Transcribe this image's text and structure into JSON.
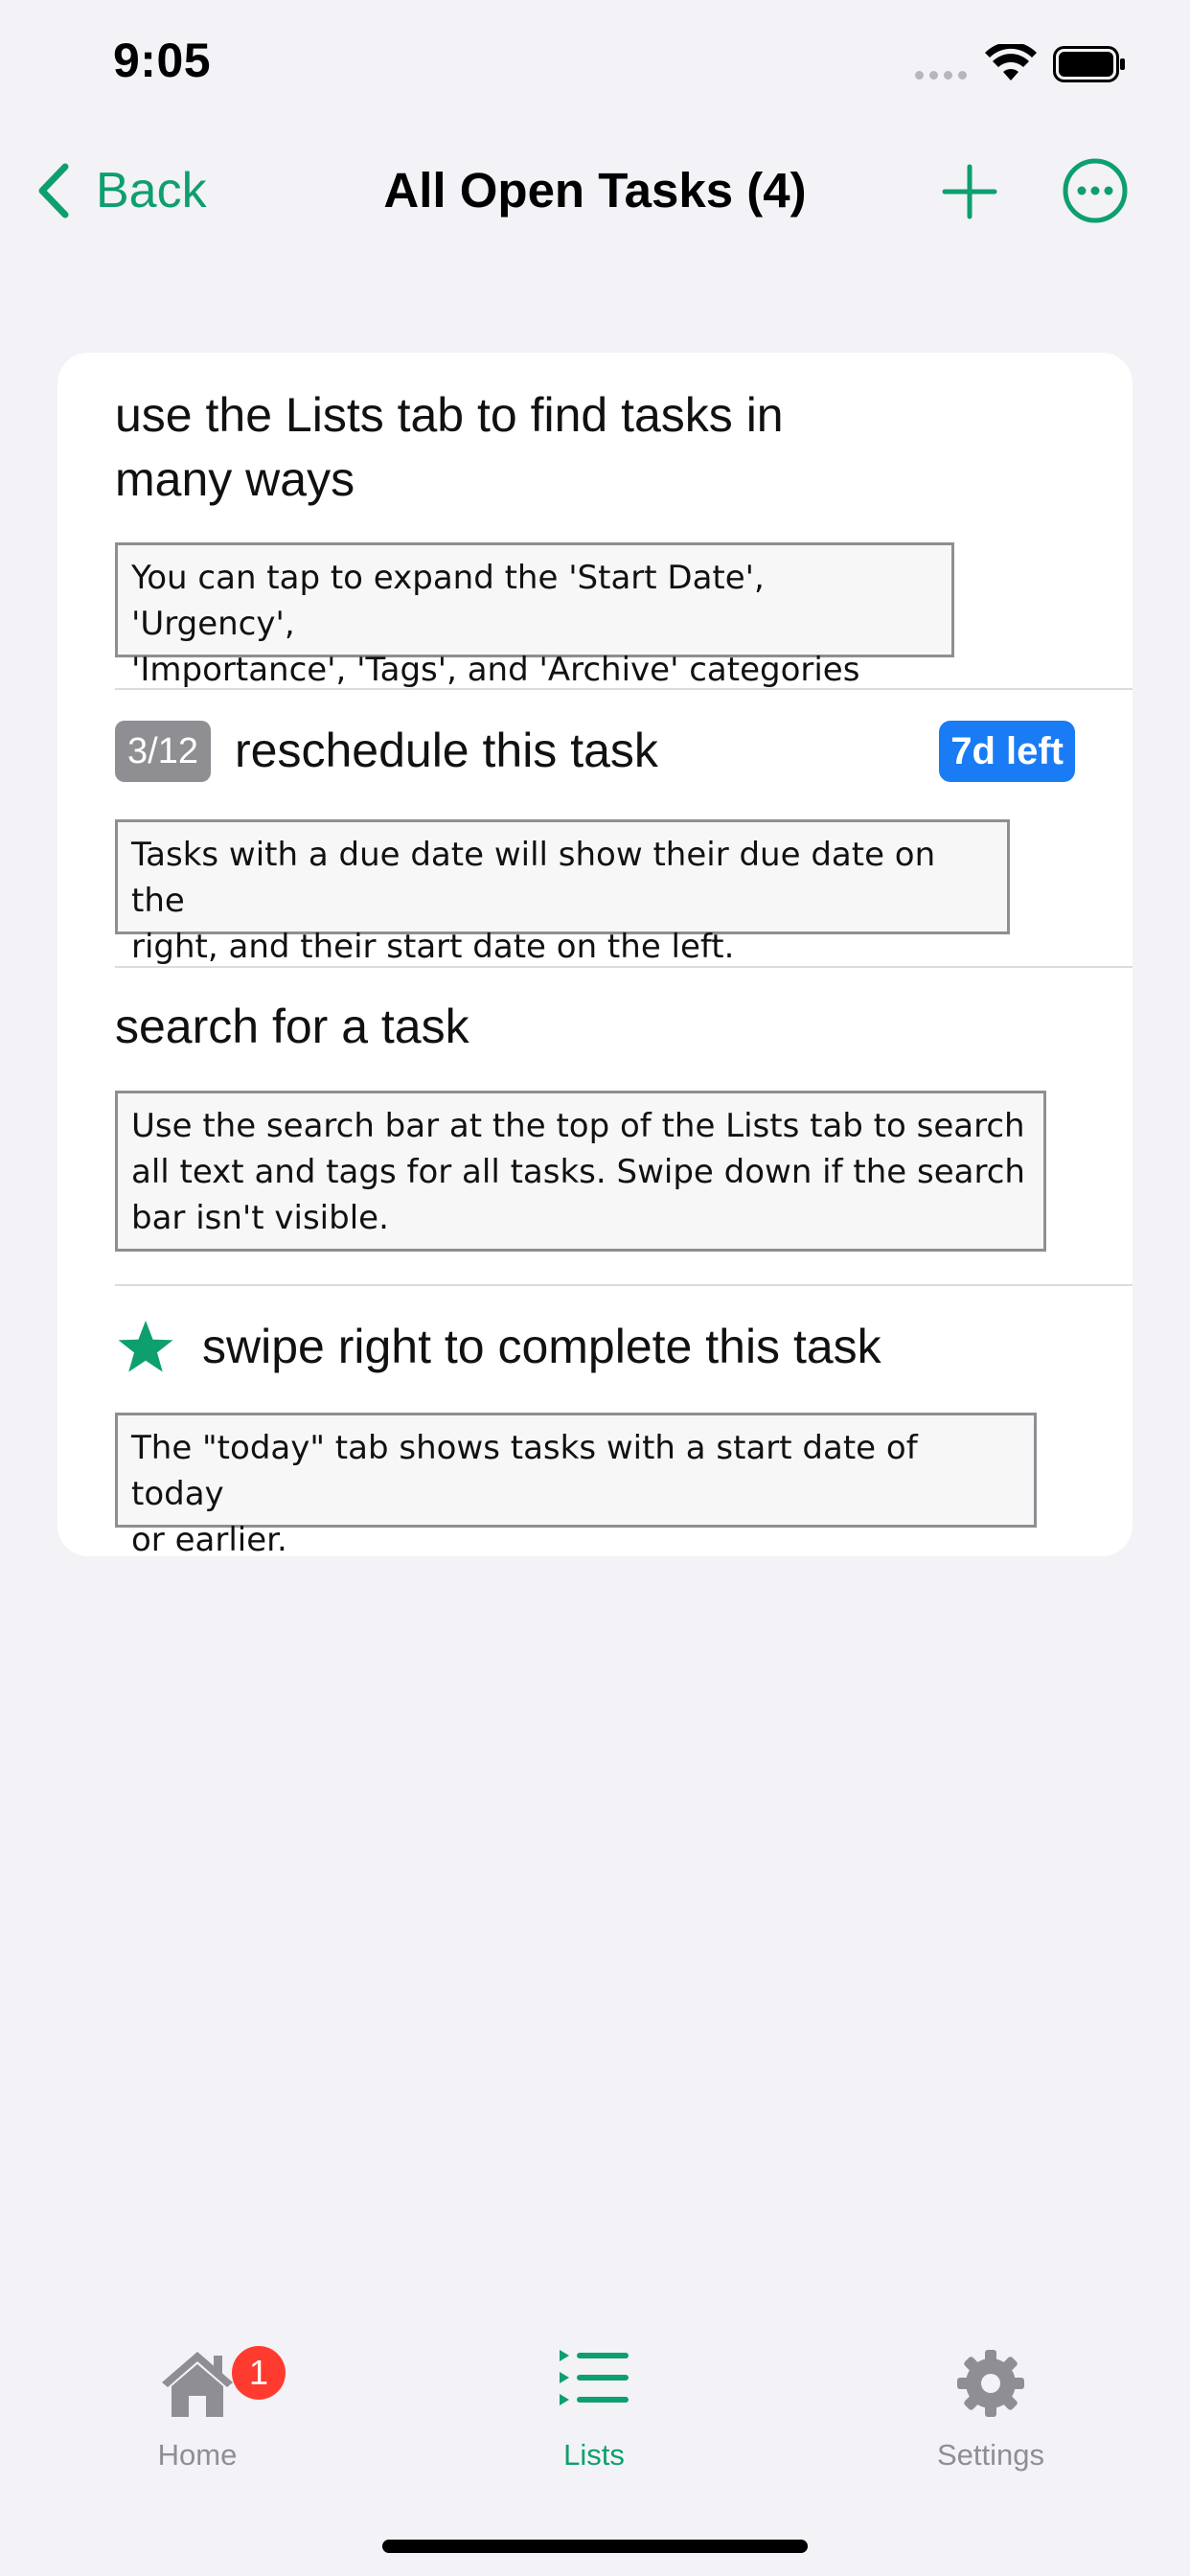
{
  "status_bar": {
    "time": "9:05"
  },
  "nav": {
    "back_label": "Back",
    "title": "All Open Tasks (4)",
    "add_icon": "plus-icon",
    "more_icon": "ellipsis-circle-icon"
  },
  "tasks": [
    {
      "title_line1": "use the Lists tab to find tasks in",
      "title_line2": "many ways",
      "note_line1": "You can tap to expand the 'Start Date', 'Urgency',",
      "note_line2": "'Importance', 'Tags', and 'Archive' categories"
    },
    {
      "start_badge": "3/12",
      "title": "reschedule this task",
      "due_badge": "7d left",
      "note_line1": "Tasks with a due date will show their due date on the",
      "note_line2": "right, and their start date on the left."
    },
    {
      "title": "search for a task",
      "note_line1": "Use the search bar at the top of the Lists tab to search",
      "note_line2": "all text and tags for all tasks.  Swipe down if the search",
      "note_line3": "bar isn't visible."
    },
    {
      "icon": "star-icon",
      "title": "swipe right to complete this task",
      "note_line1": "The \"today\" tab shows tasks with a start date of today",
      "note_line2": "or earlier."
    }
  ],
  "tab_bar": {
    "home": {
      "label": "Home",
      "badge": "1",
      "icon": "house-icon"
    },
    "lists": {
      "label": "Lists",
      "icon": "list-icon",
      "selected": true
    },
    "settings": {
      "label": "Settings",
      "icon": "gear-icon"
    }
  },
  "colors": {
    "accent": "#0e9f6e",
    "due_badge": "#1a7cf5",
    "start_badge": "#8e8e93",
    "notification_badge": "#ff3b30",
    "background": "#f2f2f7"
  }
}
